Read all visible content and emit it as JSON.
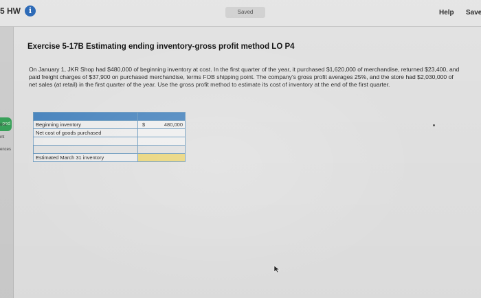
{
  "header": {
    "assignment": "5 HW",
    "status": "Saved",
    "help": "Help",
    "save": "Save"
  },
  "sidebar": {
    "tab": "ped",
    "links": [
      "ook",
      "int",
      "ences"
    ]
  },
  "exercise": {
    "title": "Exercise 5-17B Estimating ending inventory-gross profit method LO P4",
    "text": "On January 1, JKR Shop had $480,000 of beginning inventory at cost. In the first quarter of the year, it purchased $1,620,000 of merchandise, returned $23,400, and paid freight charges of $37,900 on purchased merchandise, terms FOB shipping point. The company's gross profit averages 25%, and the store had $2,030,000 of net sales (at retail) in the first quarter of the year. Use the gross profit method to estimate its cost of inventory at the end of the first quarter."
  },
  "worksheet": {
    "rows": [
      {
        "label": "Beginning inventory",
        "symbol": "$",
        "value": "480,000"
      },
      {
        "label": "Net cost of goods purchased",
        "symbol": "",
        "value": ""
      },
      {
        "label": "",
        "symbol": "",
        "value": ""
      }
    ],
    "total_label": "Estimated March 31 inventory",
    "total_value": ""
  },
  "colors": {
    "header_blue": "#4c89c4",
    "highlight_yellow": "#f2dc7c",
    "info_blue": "#2f6dbb",
    "tab_green": "#3aa55c"
  }
}
